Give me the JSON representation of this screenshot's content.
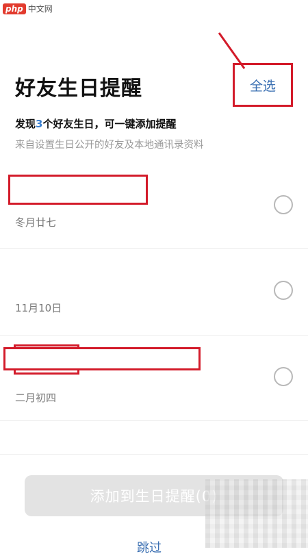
{
  "watermark": {
    "logo": "php",
    "text": "中文网"
  },
  "header": {
    "title": "好友生日提醒",
    "select_all_label": "全选"
  },
  "summary": {
    "prefix": "发现",
    "count": "3",
    "suffix": "个好友生日，可一键添加提醒"
  },
  "subtitle": "来自设置生日公开的好友及本地通讯录资料",
  "friends": [
    {
      "date": "冬月廿七"
    },
    {
      "date": "11月10日"
    },
    {
      "date": "二月初四"
    }
  ],
  "footer": {
    "add_button_label": "添加到生日提醒(0)",
    "skip_label": "跳过"
  },
  "colors": {
    "accent": "#3a6fb2",
    "annotation": "#d31b2a",
    "button_disabled": "#e3e3e3"
  }
}
